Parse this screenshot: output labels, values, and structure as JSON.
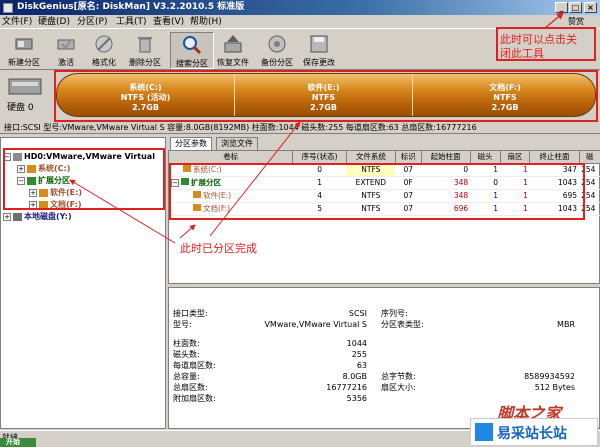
{
  "window": {
    "title": "DiskGenius[原名: DiskMan] V3.2.2010.5 标准版"
  },
  "menu": {
    "items": [
      "文件(F)",
      "硬盘(D)",
      "分区(P)",
      "工具(T)",
      "查看(V)",
      "帮助(H)"
    ]
  },
  "help_link": "赞赏",
  "toolbar": {
    "buttons": [
      "新建分区",
      "激活",
      "格式化",
      "删除分区",
      "搜索分区",
      "恢复文件",
      "备份分区",
      "保存更改"
    ]
  },
  "disk": {
    "label": "硬盘 0",
    "partitions": [
      {
        "name": "系统(C:)",
        "fs": "NTFS (活动)",
        "size": "2.7GB"
      },
      {
        "name": "软件(E:)",
        "fs": "NTFS",
        "size": "2.7GB"
      },
      {
        "name": "文档(F:)",
        "fs": "NTFS",
        "size": "2.7GB"
      }
    ]
  },
  "info_line": "接口:SCSI  型号:VMware,VMware Virtual S  容量:8.0GB(8192MB)  柱面数:1044  磁头数:255  每道扇区数:63  总扇区数:16777216",
  "tree": {
    "disk": "HD0:VMware,VMware Virtual",
    "items": [
      "系统(C:)",
      "扩展分区",
      "软件(E:)",
      "文档(F:)"
    ],
    "other": "本地磁盘(Y:)"
  },
  "tabs": [
    "分区参数",
    "浏览文件"
  ],
  "table": {
    "headers": [
      "卷标",
      "序号(状态)",
      "文件系统",
      "标识",
      "起始柱面",
      "磁头",
      "扇区",
      "终止柱面",
      "磁"
    ],
    "rows": [
      {
        "label": "系统(C:)",
        "seq": "0",
        "fs": "NTFS",
        "id": "07",
        "start_cyl": "0",
        "head": "1",
        "sector": "1",
        "end_cyl": "347",
        "last": "254"
      },
      {
        "label": "扩展分区",
        "seq": "1",
        "fs": "EXTEND",
        "id": "0F",
        "start_cyl": "348",
        "head": "0",
        "sector": "1",
        "end_cyl": "1043",
        "last": "254"
      },
      {
        "label": "软件(E:)",
        "seq": "4",
        "fs": "NTFS",
        "id": "07",
        "start_cyl": "348",
        "head": "1",
        "sector": "1",
        "end_cyl": "695",
        "last": "254"
      },
      {
        "label": "文档(F:)",
        "seq": "5",
        "fs": "NTFS",
        "id": "07",
        "start_cyl": "696",
        "head": "1",
        "sector": "1",
        "end_cyl": "1043",
        "last": "254"
      }
    ]
  },
  "details": {
    "interface_label": "接口类型:",
    "interface": "SCSI",
    "model_label": "型号:",
    "model": "VMware,VMware Virtual S",
    "serial_label": "序列号:",
    "ptable_label": "分区表类型:",
    "ptable": "MBR",
    "cyl_label": "柱面数:",
    "cyl": "1044",
    "heads_label": "磁头数:",
    "heads": "255",
    "spt_label": "每道扇区数:",
    "spt": "63",
    "cap_label": "总容量:",
    "cap": "8.0GB",
    "bytes_label": "总字节数:",
    "bytes": "8589934592",
    "sectors_label": "总扇区数:",
    "sectors": "16777216",
    "secsize_label": "扇区大小:",
    "secsize": "512 Bytes",
    "extra_label": "附加扇区数:",
    "extra": "5356"
  },
  "status": {
    "text": "就绪",
    "start": "开始"
  },
  "annotations": {
    "close_tool_line1": "此时可以点击关",
    "close_tool_line2": "闭此工具",
    "done": "此时已分区完成"
  },
  "watermark": {
    "text": "脚本之家",
    "site": "易采站长站"
  },
  "colors": {
    "accent_red": "#e02020",
    "partition_orange": "#d98a1e",
    "title_blue": "#0a246a"
  }
}
